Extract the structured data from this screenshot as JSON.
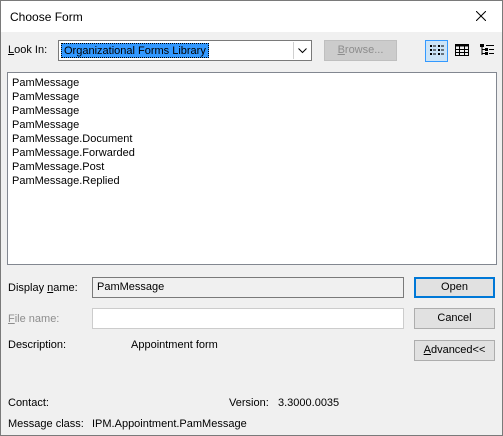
{
  "window": {
    "title": "Choose Form",
    "close_icon": "close-icon"
  },
  "look_in": {
    "label_accel": "L",
    "label_rest": "ook In:",
    "selected": "Organizational Forms Library",
    "browse_accel": "B",
    "browse_rest": "rowse..."
  },
  "views": [
    "list-view-icon",
    "details-view-icon",
    "tree-view-icon"
  ],
  "forms": [
    "PamMessage",
    "PamMessage",
    "PamMessage",
    "PamMessage",
    "PamMessage.Document",
    "PamMessage.Forwarded",
    "PamMessage.Post",
    "PamMessage.Replied"
  ],
  "display_name": {
    "label_pre": "Display ",
    "label_accel": "n",
    "label_rest": "ame:",
    "value": "PamMessage"
  },
  "file_name": {
    "label_accel": "F",
    "label_rest": "ile name:",
    "value": ""
  },
  "buttons": {
    "open": "Open",
    "cancel": "Cancel",
    "advanced_accel": "A",
    "advanced_rest": "dvanced<<"
  },
  "details": {
    "description_label": "Description:",
    "description_value": "Appointment form",
    "contact_label": "Contact:",
    "contact_value": "",
    "version_label": "Version:",
    "version_value": "3.3000.0035",
    "message_class_label": "Message class:",
    "message_class_value": "IPM.Appointment.PamMessage"
  }
}
